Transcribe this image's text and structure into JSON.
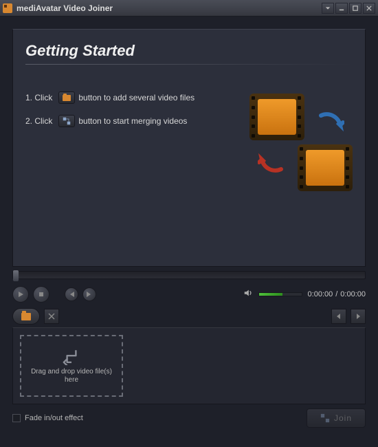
{
  "window": {
    "title": "mediAvatar Video Joiner"
  },
  "getting_started": {
    "heading": "Getting Started",
    "step1_prefix": "1. Click",
    "step1_suffix": "button to add several video files",
    "step2_prefix": "2. Click",
    "step2_suffix": "button to start merging videos"
  },
  "player": {
    "time_current": "0:00:00",
    "time_separator": "/",
    "time_total": "0:00:00",
    "volume_percent": 55
  },
  "dropzone": {
    "text": "Drag and drop video file(s) here"
  },
  "options": {
    "fade_label": "Fade in/out effect"
  },
  "actions": {
    "join_label": "Join"
  }
}
